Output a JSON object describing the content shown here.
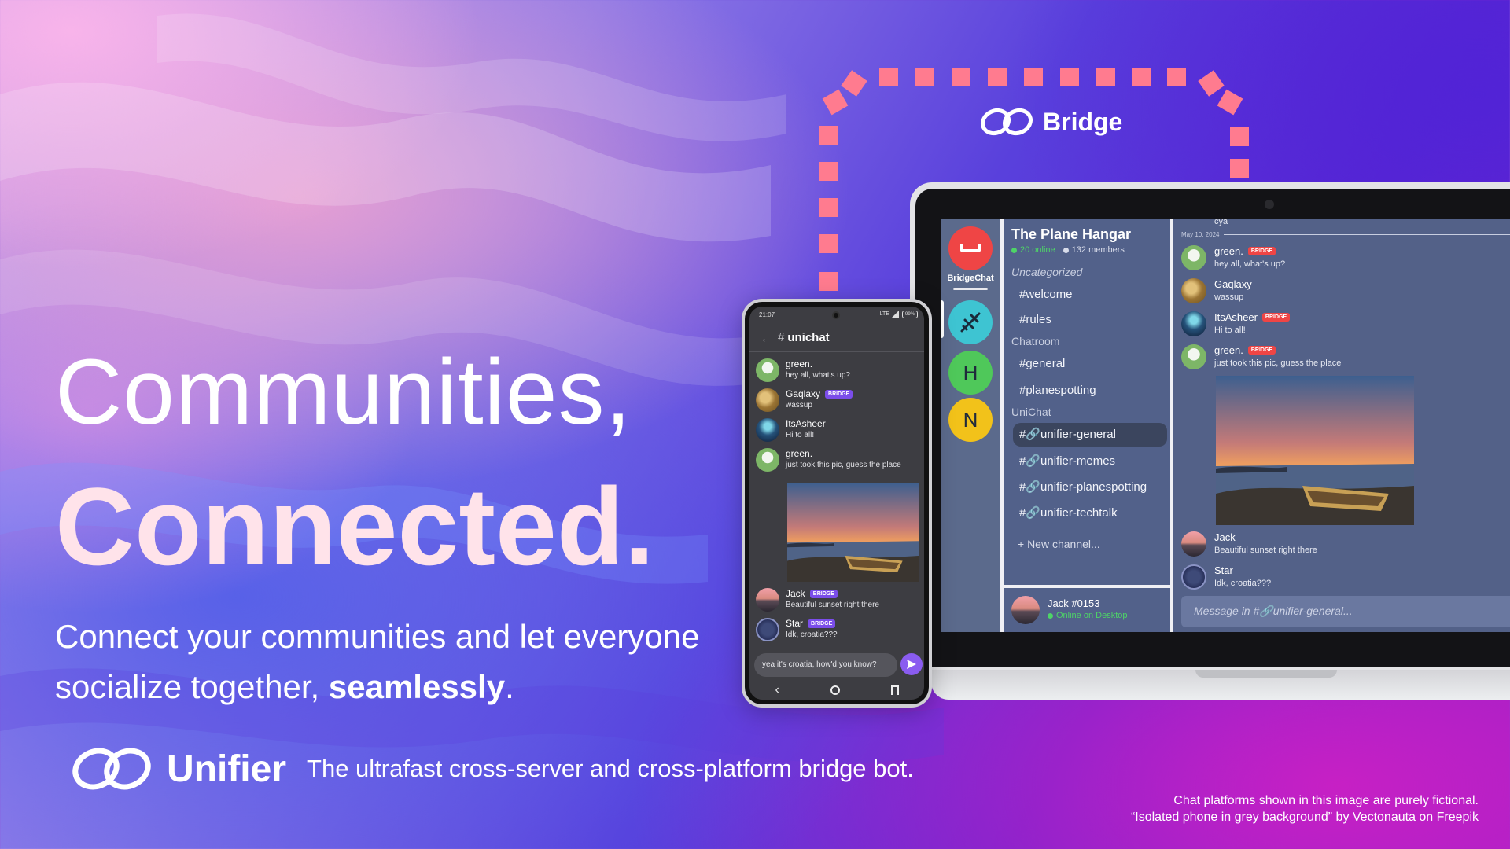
{
  "hero": {
    "headline_line1": "Communities,",
    "headline_line2": "Connected.",
    "subline_part1": "Connect your communities and let everyone socialize together, ",
    "subline_bold": "seamlessly",
    "subline_end": "."
  },
  "brand": {
    "name": "Unifier",
    "tagline": "The ultrafast cross-server and cross-platform bridge bot."
  },
  "credits": {
    "line1": "Chat platforms shown in this image are purely fictional.",
    "line2": "“Isolated phone in grey background” by Vectonauta on Freepik"
  },
  "bridge": {
    "label": "Bridge",
    "accent_color": "#ff7b8f"
  },
  "desktop_app": {
    "app_label": "BridgeChat",
    "servers": [
      {
        "icon": "plane-icon",
        "letter": "",
        "color": "#3ec4d2"
      },
      {
        "icon": "",
        "letter": "H",
        "color": "#4fc85a"
      },
      {
        "icon": "",
        "letter": "N",
        "color": "#f2c21a"
      }
    ],
    "server_name": "The Plane Hangar",
    "online": "20 online",
    "members": "132 members",
    "categories": [
      {
        "label": "Uncategorized",
        "channels": [
          "#welcome",
          "#rules"
        ]
      },
      {
        "label": "Chatroom",
        "channels": [
          "#general",
          "#planespotting"
        ]
      },
      {
        "label": "UniChat",
        "channels": [
          "#🔗unifier-general",
          "#🔗unifier-memes",
          "#🔗unifier-planespotting",
          "#🔗unifier-techtalk"
        ]
      }
    ],
    "new_channel": "+ New channel...",
    "user": {
      "name": "Jack #0153",
      "status": "Online on Desktop"
    },
    "partial_message": "cya",
    "date_separator": "May 10, 2024",
    "messages": [
      {
        "name": "green.",
        "badge": "BRIDGE",
        "text": "hey all, what's up?"
      },
      {
        "name": "Gaqlaxy",
        "badge": "",
        "text": "wassup"
      },
      {
        "name": "ItsAsheer",
        "badge": "BRIDGE",
        "text": "Hi to all!"
      },
      {
        "name": "green.",
        "badge": "BRIDGE",
        "text": "just took this pic, guess the place"
      },
      {
        "name": "Jack",
        "badge": "",
        "text": "Beautiful sunset right there"
      },
      {
        "name": "Star",
        "badge": "",
        "text": "Idk, croatia???"
      }
    ],
    "input_placeholder": "Message in #🔗unifier-general...",
    "badge_color": "#ef4545"
  },
  "mobile_app": {
    "time": "21:07",
    "battery": "99%",
    "network": "LTE",
    "channel_prefix": "#",
    "channel": "unichat",
    "messages": [
      {
        "name": "green.",
        "badge": "",
        "text": "hey all, what's up?"
      },
      {
        "name": "Gaqlaxy",
        "badge": "BRIDGE",
        "text": "wassup"
      },
      {
        "name": "ItsAsheer",
        "badge": "",
        "text": "Hi to all!"
      },
      {
        "name": "green.",
        "badge": "",
        "text": "just took this pic, guess the place"
      },
      {
        "name": "Jack",
        "badge": "BRIDGE",
        "text": "Beautiful sunset right there"
      },
      {
        "name": "Star",
        "badge": "BRIDGE",
        "text": "Idk, croatia???"
      }
    ],
    "compose_value": "yea it's croatia, how'd you know?",
    "badge_color": "#7b4dea"
  }
}
